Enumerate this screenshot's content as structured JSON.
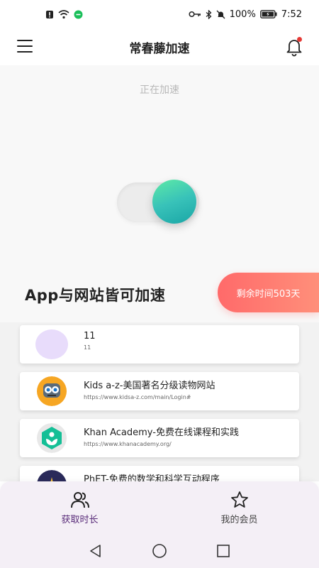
{
  "status_bar": {
    "battery": "100%",
    "time": "7:52"
  },
  "header": {
    "title": "常春藤加速"
  },
  "hero": {
    "status_text": "正在加速",
    "toggle_on": true,
    "tagline": "App与网站皆可加速",
    "remaining": "剩余时间503天"
  },
  "sites": [
    {
      "name": "11",
      "url": "11",
      "icon": "placeholder-avatar",
      "avatar_color": "#e8dcfb"
    },
    {
      "name": "Kids a-z-美国著名分级读物网站",
      "url": "https://www.kidsa-z.com/main/Login#",
      "icon": "robot-avatar",
      "avatar_color": "#f6a623"
    },
    {
      "name": "Khan Academy-免费在线课程和实践",
      "url": "https://www.khanacademy.org/",
      "icon": "khan-academy-logo",
      "avatar_color": "#14bf96"
    },
    {
      "name": "PhET-免费的数学和科学互动程序",
      "url": "",
      "icon": "phet-logo",
      "avatar_color": "#2a2a5a"
    }
  ],
  "bottom_nav": {
    "items": [
      {
        "label": "获取时长",
        "icon": "users-icon",
        "active": true
      },
      {
        "label": "我的会员",
        "icon": "star-icon",
        "active": false
      }
    ]
  },
  "colors": {
    "accent_green": "#38c2b9",
    "badge_red": "#ff6a6a",
    "nav_active": "#5a2d7a"
  }
}
